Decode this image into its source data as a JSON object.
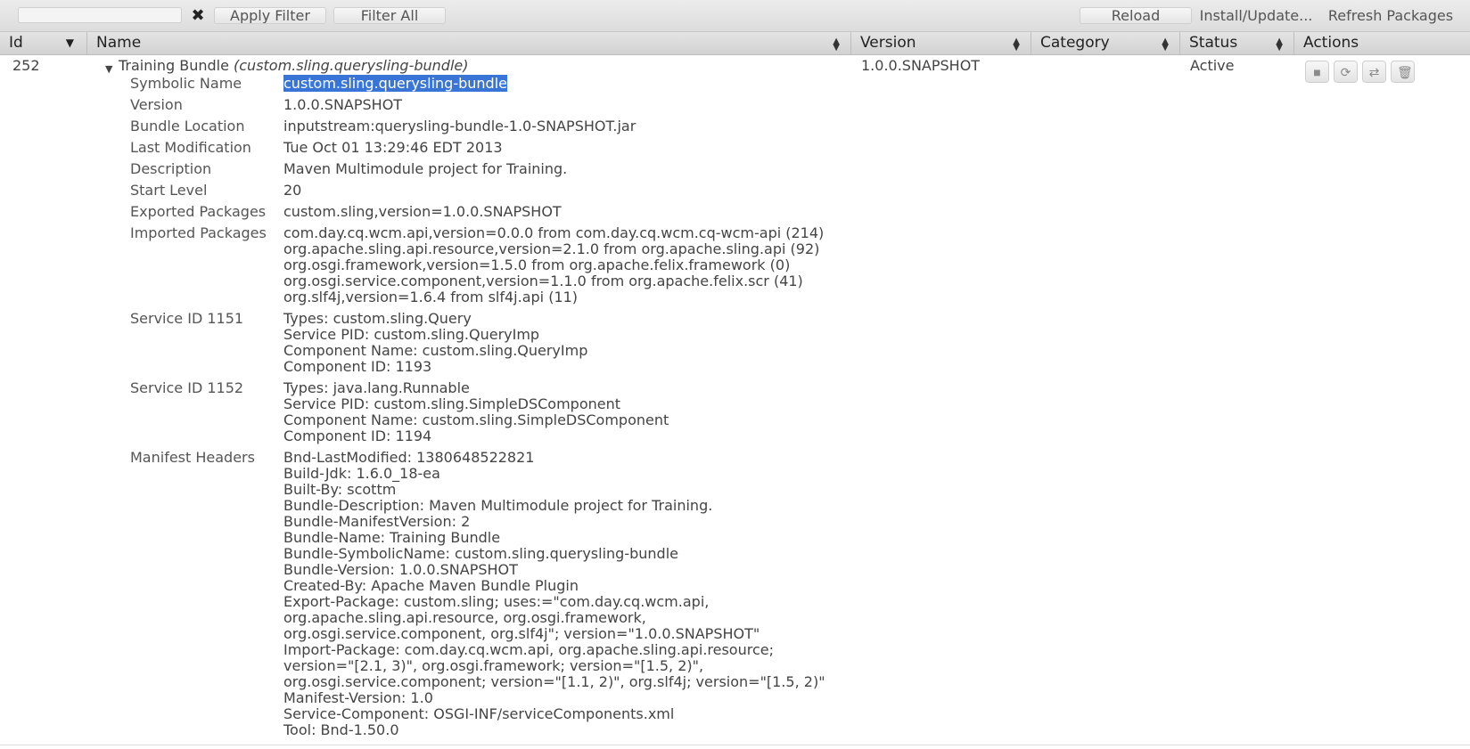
{
  "toolbar": {
    "filter_placeholder": "",
    "clear_glyph": "✖",
    "apply_filter": "Apply Filter",
    "filter_all": "Filter All",
    "reload": "Reload",
    "install_update": "Install/Update...",
    "refresh_packages": "Refresh Packages"
  },
  "columns": {
    "id": "Id",
    "name": "Name",
    "version": "Version",
    "category": "Category",
    "status": "Status",
    "actions": "Actions"
  },
  "bundle": {
    "id": "252",
    "name": "Training Bundle",
    "symbolic_paren": "(custom.sling.querysling-bundle)",
    "version": "1.0.0.SNAPSHOT",
    "status": "Active",
    "action_icons": [
      "stop-icon",
      "refresh-icon",
      "update-icon",
      "trash-icon"
    ]
  },
  "details": [
    {
      "label": "Symbolic Name",
      "lines": [
        "custom.sling.querysling-bundle"
      ],
      "selected": true
    },
    {
      "label": "Version",
      "lines": [
        "1.0.0.SNAPSHOT"
      ]
    },
    {
      "label": "Bundle Location",
      "lines": [
        "inputstream:querysling-bundle-1.0-SNAPSHOT.jar"
      ]
    },
    {
      "label": "Last Modification",
      "lines": [
        "Tue Oct 01 13:29:46 EDT 2013"
      ]
    },
    {
      "label": "Description",
      "lines": [
        "Maven Multimodule project for Training."
      ]
    },
    {
      "label": "Start Level",
      "lines": [
        "20"
      ]
    },
    {
      "label": "Exported Packages",
      "lines": [
        "custom.sling,version=1.0.0.SNAPSHOT"
      ]
    },
    {
      "label": "Imported Packages",
      "lines": [
        "com.day.cq.wcm.api,version=0.0.0 from com.day.cq.wcm.cq-wcm-api (214)",
        "org.apache.sling.api.resource,version=2.1.0 from org.apache.sling.api (92)",
        "org.osgi.framework,version=1.5.0 from org.apache.felix.framework (0)",
        "org.osgi.service.component,version=1.1.0 from org.apache.felix.scr (41)",
        "org.slf4j,version=1.6.4 from slf4j.api (11)"
      ]
    },
    {
      "label": "Service ID 1151",
      "lines": [
        "Types: custom.sling.Query",
        "Service PID: custom.sling.QueryImp",
        "Component Name: custom.sling.QueryImp",
        "Component ID: 1193"
      ]
    },
    {
      "label": "Service ID 1152",
      "lines": [
        "Types: java.lang.Runnable",
        "Service PID: custom.sling.SimpleDSComponent",
        "Component Name: custom.sling.SimpleDSComponent",
        "Component ID: 1194"
      ]
    },
    {
      "label": "Manifest Headers",
      "lines": [
        "Bnd-LastModified: 1380648522821",
        "Build-Jdk: 1.6.0_18-ea",
        "Built-By: scottm",
        "Bundle-Description: Maven Multimodule project for Training.",
        "Bundle-ManifestVersion: 2",
        "Bundle-Name: Training Bundle",
        "Bundle-SymbolicName: custom.sling.querysling-bundle",
        "Bundle-Version: 1.0.0.SNAPSHOT",
        "Created-By: Apache Maven Bundle Plugin",
        "Export-Package: custom.sling; uses:=\"com.day.cq.wcm.api,",
        "org.apache.sling.api.resource, org.osgi.framework,",
        "org.osgi.service.component, org.slf4j\"; version=\"1.0.0.SNAPSHOT\"",
        "Import-Package: com.day.cq.wcm.api, org.apache.sling.api.resource;",
        "version=\"[2.1, 3)\", org.osgi.framework; version=\"[1.5, 2)\",",
        "org.osgi.service.component; version=\"[1.1, 2)\", org.slf4j; version=\"[1.5, 2)\"",
        "Manifest-Version: 1.0",
        "Service-Component: OSGI-INF/serviceComponents.xml",
        "Tool: Bnd-1.50.0"
      ]
    }
  ]
}
